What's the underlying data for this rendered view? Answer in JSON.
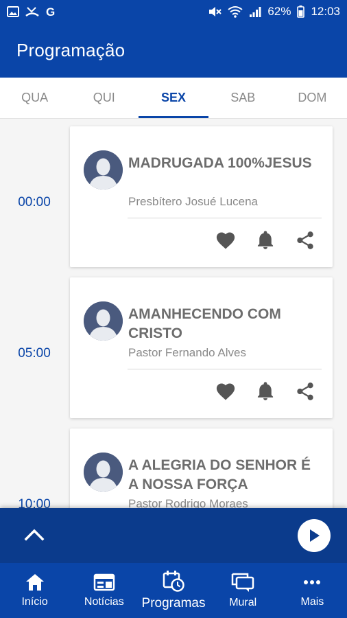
{
  "status_bar": {
    "battery": "62%",
    "time": "12:03",
    "left_icons": [
      "image-icon",
      "missed-call-icon",
      "google-icon"
    ],
    "right_icons": [
      "mute-icon",
      "wifi-icon",
      "signal-icon",
      "battery-icon"
    ]
  },
  "app_bar": {
    "title": "Programação"
  },
  "tabs": [
    {
      "label": "QUA",
      "active": false
    },
    {
      "label": "QUI",
      "active": false
    },
    {
      "label": "SEX",
      "active": true
    },
    {
      "label": "SAB",
      "active": false
    },
    {
      "label": "DOM",
      "active": false
    }
  ],
  "programs": [
    {
      "time": "00:00",
      "title": "MADRUGADA 100%JESUS",
      "host": "Presbítero Josué Lucena"
    },
    {
      "time": "05:00",
      "title": "AMANHECENDO COM CRISTO",
      "host": "Pastor Fernando Alves"
    },
    {
      "time": "10:00",
      "title": "A ALEGRIA DO SENHOR É A NOSSA FORÇA",
      "host": "Pastor Rodrigo Moraes"
    }
  ],
  "bottom_nav": [
    {
      "label": "Início",
      "icon": "home-icon"
    },
    {
      "label": "Notícias",
      "icon": "news-icon"
    },
    {
      "label": "Programas",
      "icon": "schedule-icon",
      "active": true
    },
    {
      "label": "Mural",
      "icon": "chat-icon"
    },
    {
      "label": "Mais",
      "icon": "more-icon"
    }
  ],
  "colors": {
    "primary": "#0a45a8",
    "player": "#0b3b8c",
    "time_text": "#0a45a8",
    "avatar": "#4a5a7e"
  }
}
